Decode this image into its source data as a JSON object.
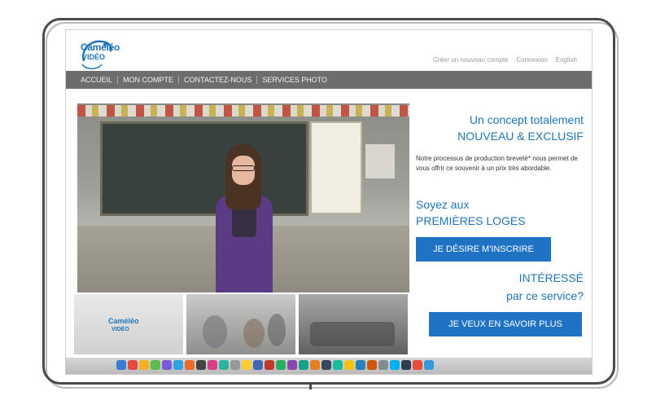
{
  "logo": {
    "line1": "Caméléo",
    "line2": "VIDÉO"
  },
  "top_links": [
    "Créer un nouveau compte",
    "Connexion",
    "English"
  ],
  "nav": [
    "ACCUEIL",
    "MON COMPTE",
    "CONTACTEZ-NOUS",
    "SERVICES PHOTO"
  ],
  "promo": {
    "headline1_line1": "Un concept totalement",
    "headline1_line2": "NOUVEAU & EXCLUSIF",
    "body": "Notre processus de production breveté* nous permet de vous offrir ce souvenir à un prix très abordable.",
    "headline2_line1": "Soyez aux",
    "headline2_line2": "PREMIÈRES LOGES",
    "signup_button": "JE DÉSIRE M'INSCRIRE",
    "headline3_line1": "INTÉRESSÉ",
    "headline3_line2": "par ce service?",
    "more_button": "JE VEUX EN SAVOIR PLUS"
  },
  "thumbnail_logo": {
    "line1": "Caméléo",
    "line2": "VIDÉO"
  },
  "dock_icon_colors": [
    "#3a7bd5",
    "#e34b3b",
    "#f3b21d",
    "#5dbb4c",
    "#7a5bd6",
    "#2fa3e0",
    "#f06b2a",
    "#444444",
    "#d93d8b",
    "#2bb3a0",
    "#999999",
    "#ffcc33",
    "#4267b2",
    "#c0392b",
    "#27ae60",
    "#8e44ad",
    "#16a085",
    "#e67e22",
    "#34495e",
    "#1abc9c",
    "#f1c40f",
    "#2980b9",
    "#d35400",
    "#7f8c8d",
    "#00aff0",
    "#2c3e50",
    "#e74c3c",
    "#3498db"
  ]
}
